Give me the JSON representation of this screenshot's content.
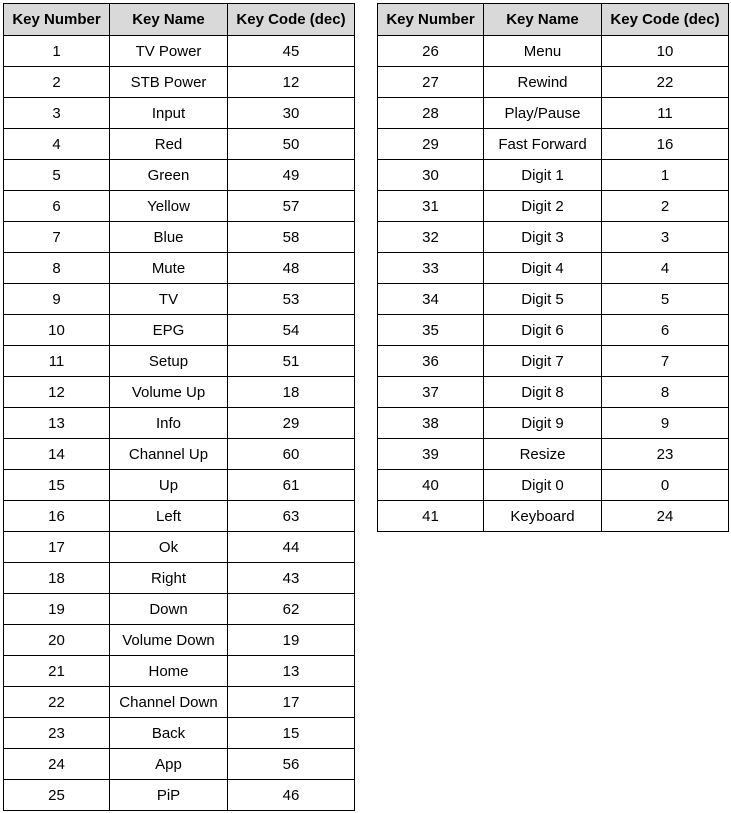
{
  "headers": [
    "Key Number",
    "Key Name",
    "Key Code (dec)"
  ],
  "left_rows": [
    {
      "num": "1",
      "name": "TV Power",
      "code": "45"
    },
    {
      "num": "2",
      "name": "STB Power",
      "code": "12"
    },
    {
      "num": "3",
      "name": "Input",
      "code": "30"
    },
    {
      "num": "4",
      "name": "Red",
      "code": "50"
    },
    {
      "num": "5",
      "name": "Green",
      "code": "49"
    },
    {
      "num": "6",
      "name": "Yellow",
      "code": "57"
    },
    {
      "num": "7",
      "name": "Blue",
      "code": "58"
    },
    {
      "num": "8",
      "name": "Mute",
      "code": "48"
    },
    {
      "num": "9",
      "name": "TV",
      "code": "53"
    },
    {
      "num": "10",
      "name": "EPG",
      "code": "54"
    },
    {
      "num": "11",
      "name": "Setup",
      "code": "51"
    },
    {
      "num": "12",
      "name": "Volume Up",
      "code": "18"
    },
    {
      "num": "13",
      "name": "Info",
      "code": "29"
    },
    {
      "num": "14",
      "name": "Channel Up",
      "code": "60"
    },
    {
      "num": "15",
      "name": "Up",
      "code": "61"
    },
    {
      "num": "16",
      "name": "Left",
      "code": "63"
    },
    {
      "num": "17",
      "name": "Ok",
      "code": "44"
    },
    {
      "num": "18",
      "name": "Right",
      "code": "43"
    },
    {
      "num": "19",
      "name": "Down",
      "code": "62"
    },
    {
      "num": "20",
      "name": "Volume Down",
      "code": "19"
    },
    {
      "num": "21",
      "name": "Home",
      "code": "13"
    },
    {
      "num": "22",
      "name": "Channel Down",
      "code": "17"
    },
    {
      "num": "23",
      "name": "Back",
      "code": "15"
    },
    {
      "num": "24",
      "name": "App",
      "code": "56"
    },
    {
      "num": "25",
      "name": "PiP",
      "code": "46"
    }
  ],
  "right_rows": [
    {
      "num": "26",
      "name": "Menu",
      "code": "10"
    },
    {
      "num": "27",
      "name": "Rewind",
      "code": "22"
    },
    {
      "num": "28",
      "name": "Play/Pause",
      "code": "11"
    },
    {
      "num": "29",
      "name": "Fast Forward",
      "code": "16"
    },
    {
      "num": "30",
      "name": "Digit 1",
      "code": "1"
    },
    {
      "num": "31",
      "name": "Digit 2",
      "code": "2"
    },
    {
      "num": "32",
      "name": "Digit 3",
      "code": "3"
    },
    {
      "num": "33",
      "name": "Digit 4",
      "code": "4"
    },
    {
      "num": "34",
      "name": "Digit 5",
      "code": "5"
    },
    {
      "num": "35",
      "name": "Digit 6",
      "code": "6"
    },
    {
      "num": "36",
      "name": "Digit 7",
      "code": "7"
    },
    {
      "num": "37",
      "name": "Digit 8",
      "code": "8"
    },
    {
      "num": "38",
      "name": "Digit 9",
      "code": "9"
    },
    {
      "num": "39",
      "name": "Resize",
      "code": "23"
    },
    {
      "num": "40",
      "name": "Digit 0",
      "code": "0"
    },
    {
      "num": "41",
      "name": "Keyboard",
      "code": "24"
    }
  ],
  "colors": {
    "header_bg": "#d9d9d9",
    "border": "#000000"
  }
}
